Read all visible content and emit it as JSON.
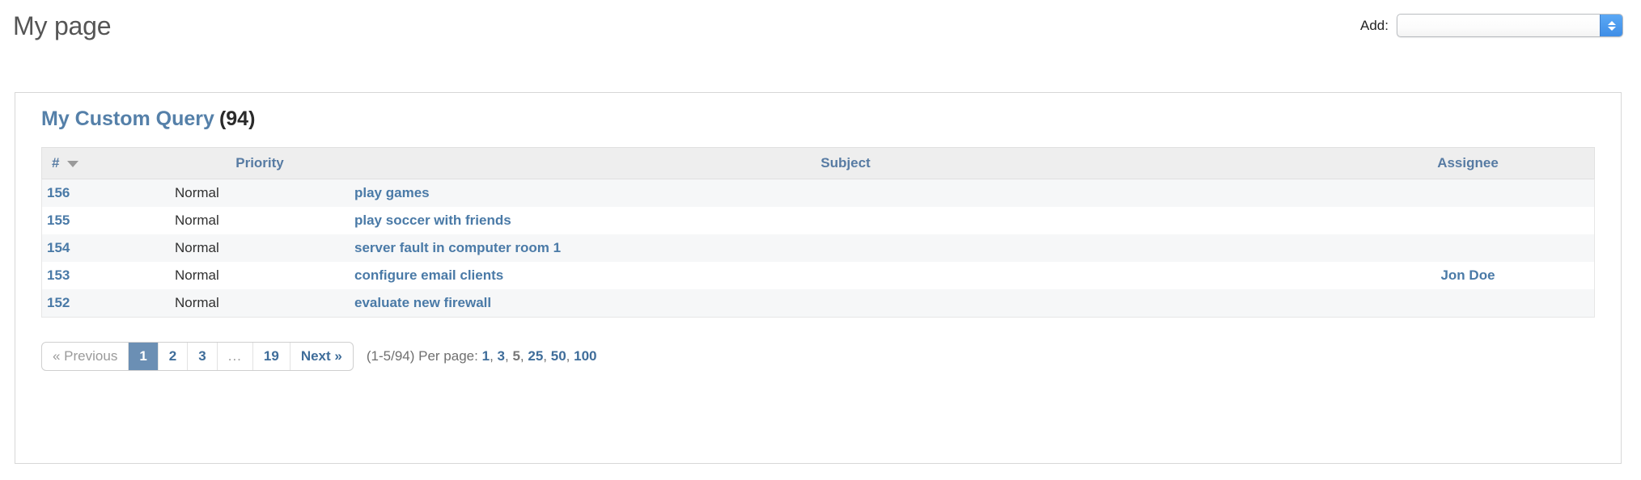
{
  "header": {
    "page_title": "My page",
    "add_label": "Add:",
    "add_select": {
      "selected_value": "",
      "options": []
    }
  },
  "block": {
    "query_name": "My Custom Query",
    "query_count": "(94)",
    "table": {
      "columns": [
        {
          "key": "id",
          "label": "#",
          "sorted": true,
          "sort_dir": "desc"
        },
        {
          "key": "priority",
          "label": "Priority"
        },
        {
          "key": "subject",
          "label": "Subject"
        },
        {
          "key": "assignee",
          "label": "Assignee"
        }
      ],
      "rows": [
        {
          "id": "156",
          "priority": "Normal",
          "subject": "play games",
          "assignee": ""
        },
        {
          "id": "155",
          "priority": "Normal",
          "subject": "play soccer with friends",
          "assignee": ""
        },
        {
          "id": "154",
          "priority": "Normal",
          "subject": "server fault in computer room 1",
          "assignee": ""
        },
        {
          "id": "153",
          "priority": "Normal",
          "subject": "configure email clients",
          "assignee": "Jon Doe"
        },
        {
          "id": "152",
          "priority": "Normal",
          "subject": "evaluate new firewall",
          "assignee": ""
        }
      ]
    },
    "pagination": {
      "previous_label": "« Previous",
      "previous_disabled": true,
      "pages": [
        "1",
        "2",
        "3",
        "...",
        "19"
      ],
      "current_page": "1",
      "next_label": "Next »",
      "range_label": "(1-5/94)",
      "per_page_label": "Per page:",
      "per_page_options": [
        "1",
        "3",
        "5",
        "25",
        "50",
        "100"
      ],
      "per_page_current": "5"
    }
  },
  "colors": {
    "link_blue": "#4a7aa7",
    "header_blue": "#577ba3",
    "active_page_bg": "#6b8fb4",
    "title_gray": "#555555",
    "row_stripe": "#f6f7f8",
    "thead_bg": "#eeeeee",
    "panel_border": "#d7d7d7",
    "select_button_blue": "#3f8ee6"
  }
}
